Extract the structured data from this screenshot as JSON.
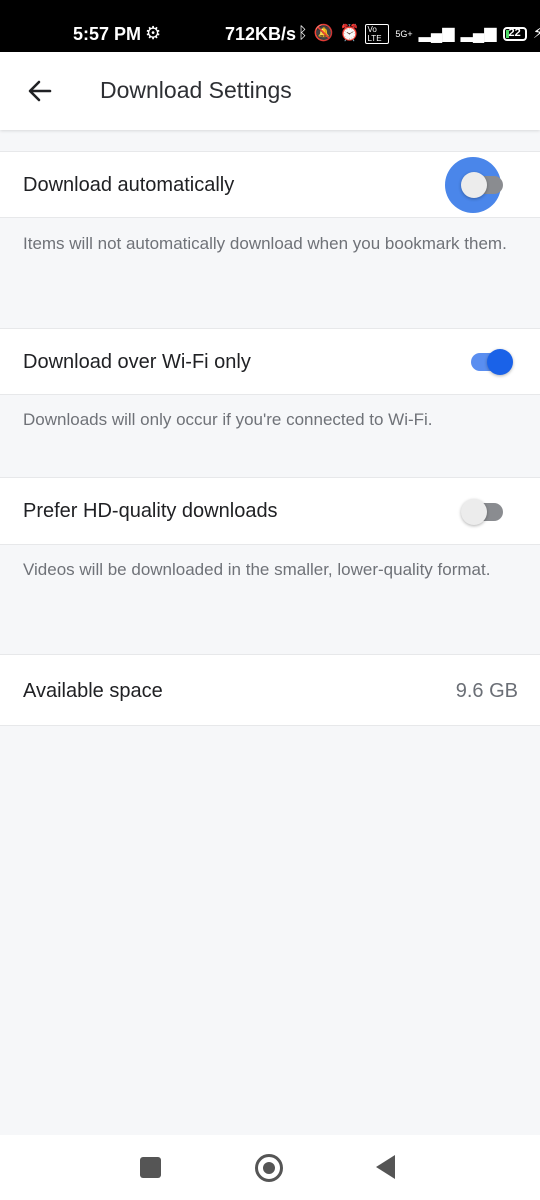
{
  "status_bar": {
    "time": "5:57 PM",
    "net_speed": "712KB/s",
    "network": "5G+",
    "volte": "Vo LTE",
    "battery": "22",
    "icons": [
      "settings-gear-icon",
      "bluetooth-icon",
      "mute-icon",
      "alarm-icon",
      "volte-icon",
      "signal-icon",
      "signal-icon",
      "battery-icon",
      "charging-icon"
    ]
  },
  "appbar": {
    "title": "Download Settings",
    "back_icon": "arrow-left-icon"
  },
  "settings": [
    {
      "label": "Download automatically",
      "description": "Items will not automatically download when you bookmark them.",
      "enabled": false,
      "focused": true
    },
    {
      "label": "Download over Wi-Fi only",
      "description": "Downloads will only occur if you're connected to Wi-Fi.",
      "enabled": true,
      "focused": false
    },
    {
      "label": "Prefer HD-quality downloads",
      "description": "Videos will be downloaded in the smaller, lower-quality format.",
      "enabled": false,
      "focused": false
    }
  ],
  "storage": {
    "label": "Available space",
    "value": "9.6 GB"
  },
  "navbar": {
    "icons": [
      "recents-square-icon",
      "home-circle-icon",
      "back-triangle-icon"
    ]
  },
  "colors": {
    "accent": "#1a62e8",
    "focus_halo": "#4a86ea",
    "background": "#f6f7f9",
    "surface": "#ffffff"
  }
}
